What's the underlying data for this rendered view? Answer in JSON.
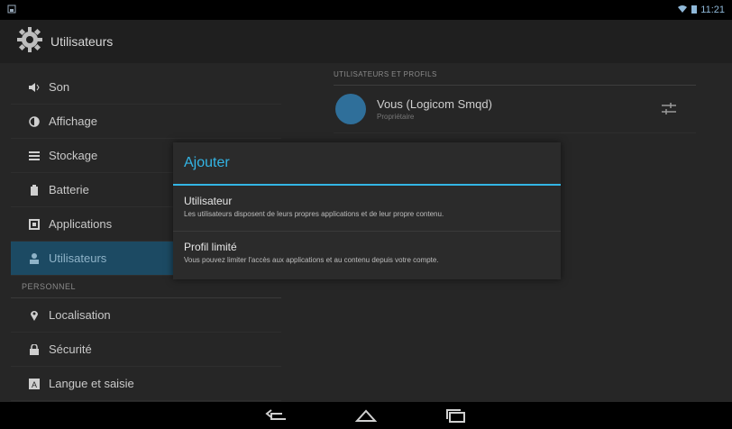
{
  "status": {
    "time": "11:21"
  },
  "actionbar": {
    "title": "Utilisateurs"
  },
  "sidebar": {
    "items_top": [
      {
        "label": "Son",
        "icon": "volume-icon"
      },
      {
        "label": "Affichage",
        "icon": "brightness-icon"
      },
      {
        "label": "Stockage",
        "icon": "storage-icon"
      },
      {
        "label": "Batterie",
        "icon": "battery-icon"
      },
      {
        "label": "Applications",
        "icon": "apps-icon"
      },
      {
        "label": "Utilisateurs",
        "icon": "user-icon",
        "selected": true
      }
    ],
    "section_personal": "PERSONNEL",
    "items_personal": [
      {
        "label": "Localisation",
        "icon": "location-icon"
      },
      {
        "label": "Sécurité",
        "icon": "lock-icon"
      },
      {
        "label": "Langue et saisie",
        "icon": "keyboard-icon"
      }
    ]
  },
  "pane": {
    "header": "UTILISATEURS ET PROFILS",
    "profile": {
      "name": "Vous (Logicom Smqd)",
      "sub": "Propriétaire"
    }
  },
  "dialog": {
    "title": "Ajouter",
    "options": [
      {
        "title": "Utilisateur",
        "desc": "Les utilisateurs disposent de leurs propres applications et de leur propre contenu."
      },
      {
        "title": "Profil limité",
        "desc": "Vous pouvez limiter l'accès aux applications et au contenu depuis votre compte."
      }
    ]
  },
  "colors": {
    "accent": "#33b5e5",
    "selected_bg": "#1c4a63"
  }
}
